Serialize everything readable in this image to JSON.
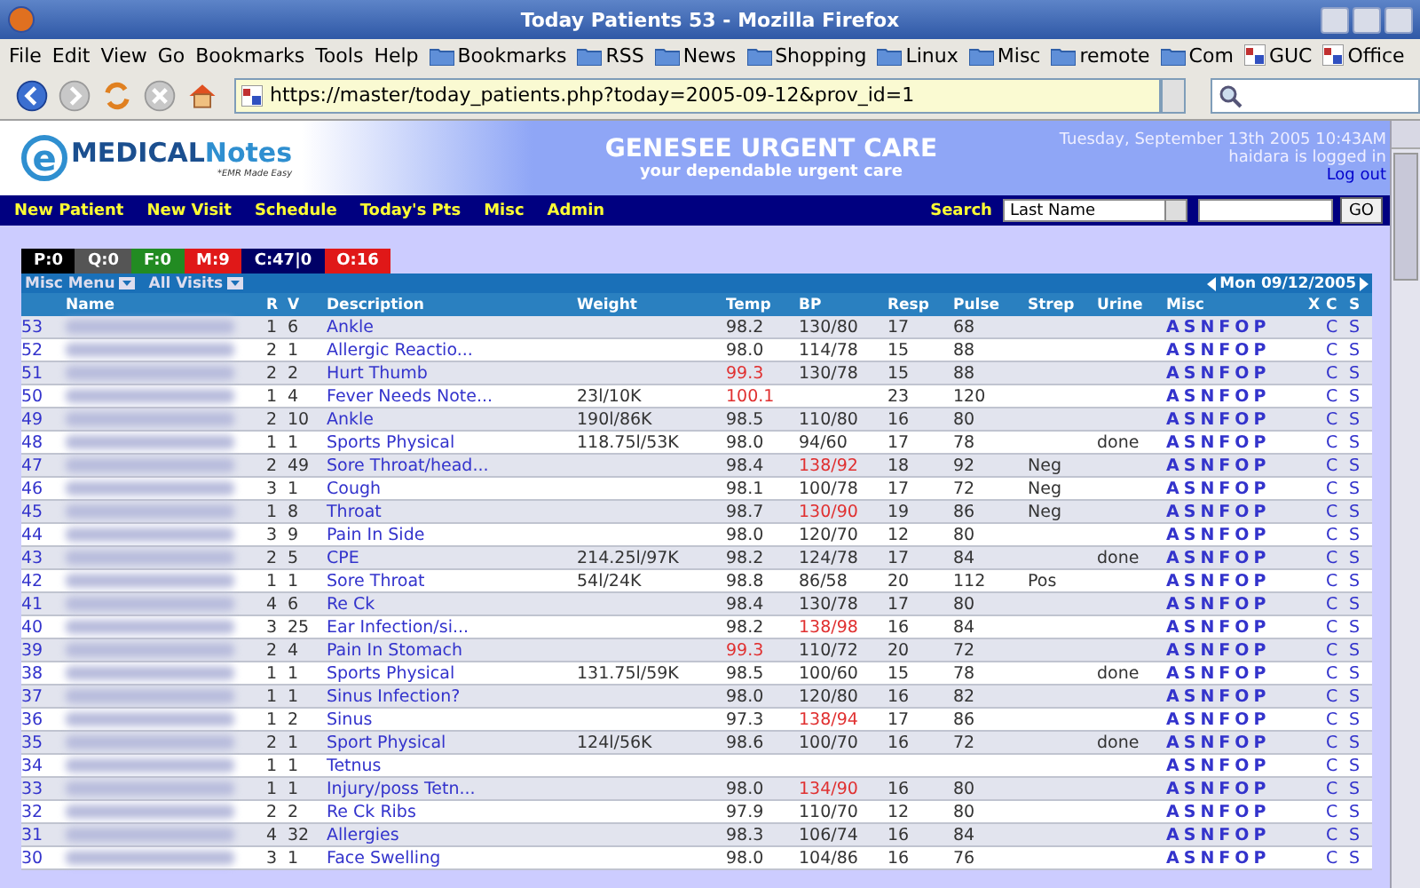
{
  "window": {
    "title": "Today Patients 53 - Mozilla Firefox"
  },
  "menu": [
    "File",
    "Edit",
    "View",
    "Go",
    "Bookmarks",
    "Tools",
    "Help"
  ],
  "bookmarks": [
    {
      "label": "Bookmarks",
      "kind": "folder"
    },
    {
      "label": "RSS",
      "kind": "folder"
    },
    {
      "label": "News",
      "kind": "folder"
    },
    {
      "label": "Shopping",
      "kind": "folder"
    },
    {
      "label": "Linux",
      "kind": "folder"
    },
    {
      "label": "Misc",
      "kind": "folder"
    },
    {
      "label": "remote",
      "kind": "folder"
    },
    {
      "label": "Com",
      "kind": "folder"
    },
    {
      "label": "GUC",
      "kind": "site"
    },
    {
      "label": "Office",
      "kind": "site"
    }
  ],
  "address": {
    "url": "https://master/today_patients.php?today=2005-09-12&prov_id=1"
  },
  "banner": {
    "logo_letter": "e",
    "logo_text": "MEDICAL",
    "logo_text2": "Notes",
    "tagline": "*EMR Made Easy",
    "clinic": "GENESEE URGENT CARE",
    "slogan": "your dependable urgent care",
    "date": "Tuesday, September 13th 2005 10:43AM",
    "login": "haidara is logged in",
    "logout": "Log out"
  },
  "nav": {
    "items": [
      "New Patient",
      "New Visit",
      "Schedule",
      "Today's Pts",
      "Misc",
      "Admin"
    ],
    "search_label": "Search",
    "search_select": "Last Name",
    "go": "GO"
  },
  "counters": [
    {
      "label": "P:0",
      "color": "#000000"
    },
    {
      "label": "Q:0",
      "color": "#555555"
    },
    {
      "label": "F:0",
      "color": "#228b22"
    },
    {
      "label": "M:9",
      "color": "#e01818"
    },
    {
      "label": "C:47|0",
      "color": "#000066"
    },
    {
      "label": "O:16",
      "color": "#e01818"
    }
  ],
  "table": {
    "menus": [
      "Misc Menu",
      "All Visits"
    ],
    "date_nav": "Mon 09/12/2005",
    "columns": [
      "Name",
      "R",
      "V",
      "Description",
      "Weight",
      "Temp",
      "BP",
      "Resp",
      "Pulse",
      "Strep",
      "Urine",
      "Misc",
      "X",
      "C",
      "S"
    ],
    "rows": [
      {
        "num": "53",
        "r": "1",
        "v": "6",
        "desc": "Ankle",
        "weight": "",
        "temp": "98.2",
        "temp_alert": false,
        "bp": "130/80",
        "bp_alert": false,
        "resp": "17",
        "pulse": "68",
        "strep": "",
        "urine": "",
        "misc": [
          "A",
          "S",
          "N",
          "F",
          "O",
          "P"
        ],
        "actions": [
          "C",
          "S"
        ]
      },
      {
        "num": "52",
        "r": "2",
        "v": "1",
        "desc": "Allergic Reactio...",
        "weight": "",
        "temp": "98.0",
        "temp_alert": false,
        "bp": "114/78",
        "bp_alert": false,
        "resp": "15",
        "pulse": "88",
        "strep": "",
        "urine": "",
        "misc": [
          "A",
          "S",
          "N",
          "F",
          "O",
          "P"
        ],
        "actions": [
          "C",
          "S"
        ]
      },
      {
        "num": "51",
        "r": "2",
        "v": "2",
        "desc": "Hurt Thumb",
        "weight": "",
        "temp": "99.3",
        "temp_alert": true,
        "bp": "130/78",
        "bp_alert": false,
        "resp": "15",
        "pulse": "88",
        "strep": "",
        "urine": "",
        "misc": [
          "A",
          "S",
          "N",
          "F",
          "O",
          "P"
        ],
        "actions": [
          "C",
          "S"
        ]
      },
      {
        "num": "50",
        "r": "1",
        "v": "4",
        "desc": "Fever Needs Note...",
        "weight": "23l/10K",
        "temp": "100.1",
        "temp_alert": true,
        "bp": "",
        "resp": "23",
        "pulse": "120",
        "strep": "",
        "urine": "",
        "misc": [
          "A",
          "S",
          "N",
          "F",
          "O",
          "P"
        ],
        "actions": [
          "C",
          "S"
        ]
      },
      {
        "num": "49",
        "r": "2",
        "v": "10",
        "desc": "Ankle",
        "weight": "190l/86K",
        "temp": "98.5",
        "temp_alert": false,
        "bp": "110/80",
        "bp_alert": false,
        "resp": "16",
        "pulse": "80",
        "strep": "",
        "urine": "",
        "misc": [
          "A",
          "S",
          "N",
          "F",
          "O",
          "P"
        ],
        "actions": [
          "C",
          "S"
        ]
      },
      {
        "num": "48",
        "r": "1",
        "v": "1",
        "desc": "Sports Physical",
        "weight": "118.75l/53K",
        "temp": "98.0",
        "temp_alert": false,
        "bp": "94/60",
        "bp_alert": false,
        "resp": "17",
        "pulse": "78",
        "strep": "",
        "urine": "done",
        "misc": [
          "A",
          "S",
          "N",
          "F",
          "O",
          "P"
        ],
        "actions": [
          "C",
          "S"
        ]
      },
      {
        "num": "47",
        "r": "2",
        "v": "49",
        "desc": "Sore Throat/head...",
        "weight": "",
        "temp": "98.4",
        "temp_alert": false,
        "bp": "138/92",
        "bp_alert": true,
        "resp": "18",
        "pulse": "92",
        "strep": "Neg",
        "urine": "",
        "misc": [
          "A",
          "S",
          "N",
          "F",
          "O",
          "P"
        ],
        "actions": [
          "C",
          "S"
        ]
      },
      {
        "num": "46",
        "r": "3",
        "v": "1",
        "desc": "Cough",
        "weight": "",
        "temp": "98.1",
        "temp_alert": false,
        "bp": "100/78",
        "bp_alert": false,
        "resp": "17",
        "pulse": "72",
        "strep": "Neg",
        "urine": "",
        "misc": [
          "A",
          "S",
          "N",
          "F",
          "O",
          "P"
        ],
        "actions": [
          "C",
          "S"
        ]
      },
      {
        "num": "45",
        "r": "1",
        "v": "8",
        "desc": "Throat",
        "weight": "",
        "temp": "98.7",
        "temp_alert": false,
        "bp": "130/90",
        "bp_alert": true,
        "resp": "19",
        "pulse": "86",
        "strep": "Neg",
        "urine": "",
        "misc": [
          "A",
          "S",
          "N",
          "F",
          "O",
          "P"
        ],
        "actions": [
          "C",
          "S"
        ]
      },
      {
        "num": "44",
        "r": "3",
        "v": "9",
        "desc": "Pain In Side",
        "weight": "",
        "temp": "98.0",
        "temp_alert": false,
        "bp": "120/70",
        "bp_alert": false,
        "resp": "12",
        "pulse": "80",
        "strep": "",
        "urine": "",
        "misc": [
          "A",
          "S",
          "N",
          "F",
          "O",
          "P"
        ],
        "actions": [
          "C",
          "S"
        ]
      },
      {
        "num": "43",
        "r": "2",
        "v": "5",
        "desc": "CPE",
        "weight": "214.25l/97K",
        "temp": "98.2",
        "temp_alert": false,
        "bp": "124/78",
        "bp_alert": false,
        "resp": "17",
        "pulse": "84",
        "strep": "",
        "urine": "done",
        "misc": [
          "A",
          "S",
          "N",
          "F",
          "O",
          "P"
        ],
        "actions": [
          "C",
          "S"
        ]
      },
      {
        "num": "42",
        "r": "1",
        "v": "1",
        "desc": "Sore Throat",
        "weight": "54l/24K",
        "temp": "98.8",
        "temp_alert": false,
        "bp": "86/58",
        "bp_alert": false,
        "resp": "20",
        "pulse": "112",
        "strep": "Pos",
        "urine": "",
        "misc": [
          "A",
          "S",
          "N",
          "F",
          "O",
          "P"
        ],
        "actions": [
          "C",
          "S"
        ]
      },
      {
        "num": "41",
        "r": "4",
        "v": "6",
        "desc": "Re Ck",
        "weight": "",
        "temp": "98.4",
        "temp_alert": false,
        "bp": "130/78",
        "bp_alert": false,
        "resp": "17",
        "pulse": "80",
        "strep": "",
        "urine": "",
        "misc": [
          "A",
          "S",
          "N",
          "F",
          "O",
          "P"
        ],
        "actions": [
          "C",
          "S"
        ]
      },
      {
        "num": "40",
        "r": "3",
        "v": "25",
        "desc": "Ear Infection/si...",
        "weight": "",
        "temp": "98.2",
        "temp_alert": false,
        "bp": "138/98",
        "bp_alert": true,
        "resp": "16",
        "pulse": "84",
        "strep": "",
        "urine": "",
        "misc": [
          "A",
          "S",
          "N",
          "F",
          "O",
          "P"
        ],
        "actions": [
          "C",
          "S"
        ]
      },
      {
        "num": "39",
        "r": "2",
        "v": "4",
        "desc": "Pain In Stomach",
        "weight": "",
        "temp": "99.3",
        "temp_alert": true,
        "bp": "110/72",
        "bp_alert": false,
        "resp": "20",
        "pulse": "72",
        "strep": "",
        "urine": "",
        "misc": [
          "A",
          "S",
          "N",
          "F",
          "O",
          "P"
        ],
        "actions": [
          "C",
          "S"
        ]
      },
      {
        "num": "38",
        "r": "1",
        "v": "1",
        "desc": "Sports Physical",
        "weight": "131.75l/59K",
        "temp": "98.5",
        "temp_alert": false,
        "bp": "100/60",
        "bp_alert": false,
        "resp": "15",
        "pulse": "78",
        "strep": "",
        "urine": "done",
        "misc": [
          "A",
          "S",
          "N",
          "F",
          "O",
          "P"
        ],
        "actions": [
          "C",
          "S"
        ]
      },
      {
        "num": "37",
        "r": "1",
        "v": "1",
        "desc": "Sinus Infection?",
        "weight": "",
        "temp": "98.0",
        "temp_alert": false,
        "bp": "120/80",
        "bp_alert": false,
        "resp": "16",
        "pulse": "82",
        "strep": "",
        "urine": "",
        "misc": [
          "A",
          "S",
          "N",
          "F",
          "O",
          "P"
        ],
        "actions": [
          "C",
          "S"
        ]
      },
      {
        "num": "36",
        "r": "1",
        "v": "2",
        "desc": "Sinus",
        "weight": "",
        "temp": "97.3",
        "temp_alert": false,
        "bp": "138/94",
        "bp_alert": true,
        "resp": "17",
        "pulse": "86",
        "strep": "",
        "urine": "",
        "misc": [
          "A",
          "S",
          "N",
          "F",
          "O",
          "P"
        ],
        "actions": [
          "C",
          "S"
        ]
      },
      {
        "num": "35",
        "r": "2",
        "v": "1",
        "desc": "Sport Physical",
        "weight": "124l/56K",
        "temp": "98.6",
        "temp_alert": false,
        "bp": "100/70",
        "bp_alert": false,
        "resp": "16",
        "pulse": "72",
        "strep": "",
        "urine": "done",
        "misc": [
          "A",
          "S",
          "N",
          "F",
          "O",
          "P"
        ],
        "actions": [
          "C",
          "S"
        ]
      },
      {
        "num": "34",
        "r": "1",
        "v": "1",
        "desc": "Tetnus",
        "weight": "",
        "temp": "",
        "bp": "",
        "resp": "",
        "pulse": "",
        "strep": "",
        "urine": "",
        "misc": [
          "A",
          "S",
          "N",
          "F",
          "O",
          "P"
        ],
        "actions": [
          "C",
          "S"
        ]
      },
      {
        "num": "33",
        "r": "1",
        "v": "1",
        "desc": "Injury/poss Tetn...",
        "weight": "",
        "temp": "98.0",
        "temp_alert": false,
        "bp": "134/90",
        "bp_alert": true,
        "resp": "16",
        "pulse": "80",
        "strep": "",
        "urine": "",
        "misc": [
          "A",
          "S",
          "N",
          "F",
          "O",
          "P"
        ],
        "actions": [
          "C",
          "S"
        ]
      },
      {
        "num": "32",
        "r": "2",
        "v": "2",
        "desc": "Re Ck Ribs",
        "weight": "",
        "temp": "97.9",
        "temp_alert": false,
        "bp": "110/70",
        "bp_alert": false,
        "resp": "12",
        "pulse": "80",
        "strep": "",
        "urine": "",
        "misc": [
          "A",
          "S",
          "N",
          "F",
          "O",
          "P"
        ],
        "actions": [
          "C",
          "S"
        ]
      },
      {
        "num": "31",
        "r": "4",
        "v": "32",
        "desc": "Allergies",
        "weight": "",
        "temp": "98.3",
        "temp_alert": false,
        "bp": "106/74",
        "bp_alert": false,
        "resp": "16",
        "pulse": "84",
        "strep": "",
        "urine": "",
        "misc": [
          "A",
          "S",
          "N",
          "F",
          "O",
          "P"
        ],
        "actions": [
          "C",
          "S"
        ]
      },
      {
        "num": "30",
        "r": "3",
        "v": "1",
        "desc": "Face Swelling",
        "weight": "",
        "temp": "98.0",
        "temp_alert": false,
        "bp": "104/86",
        "bp_alert": false,
        "resp": "16",
        "pulse": "76",
        "strep": "",
        "urine": "",
        "misc": [
          "A",
          "S",
          "N",
          "F",
          "O",
          "P"
        ],
        "actions": [
          "C",
          "S"
        ]
      }
    ]
  }
}
